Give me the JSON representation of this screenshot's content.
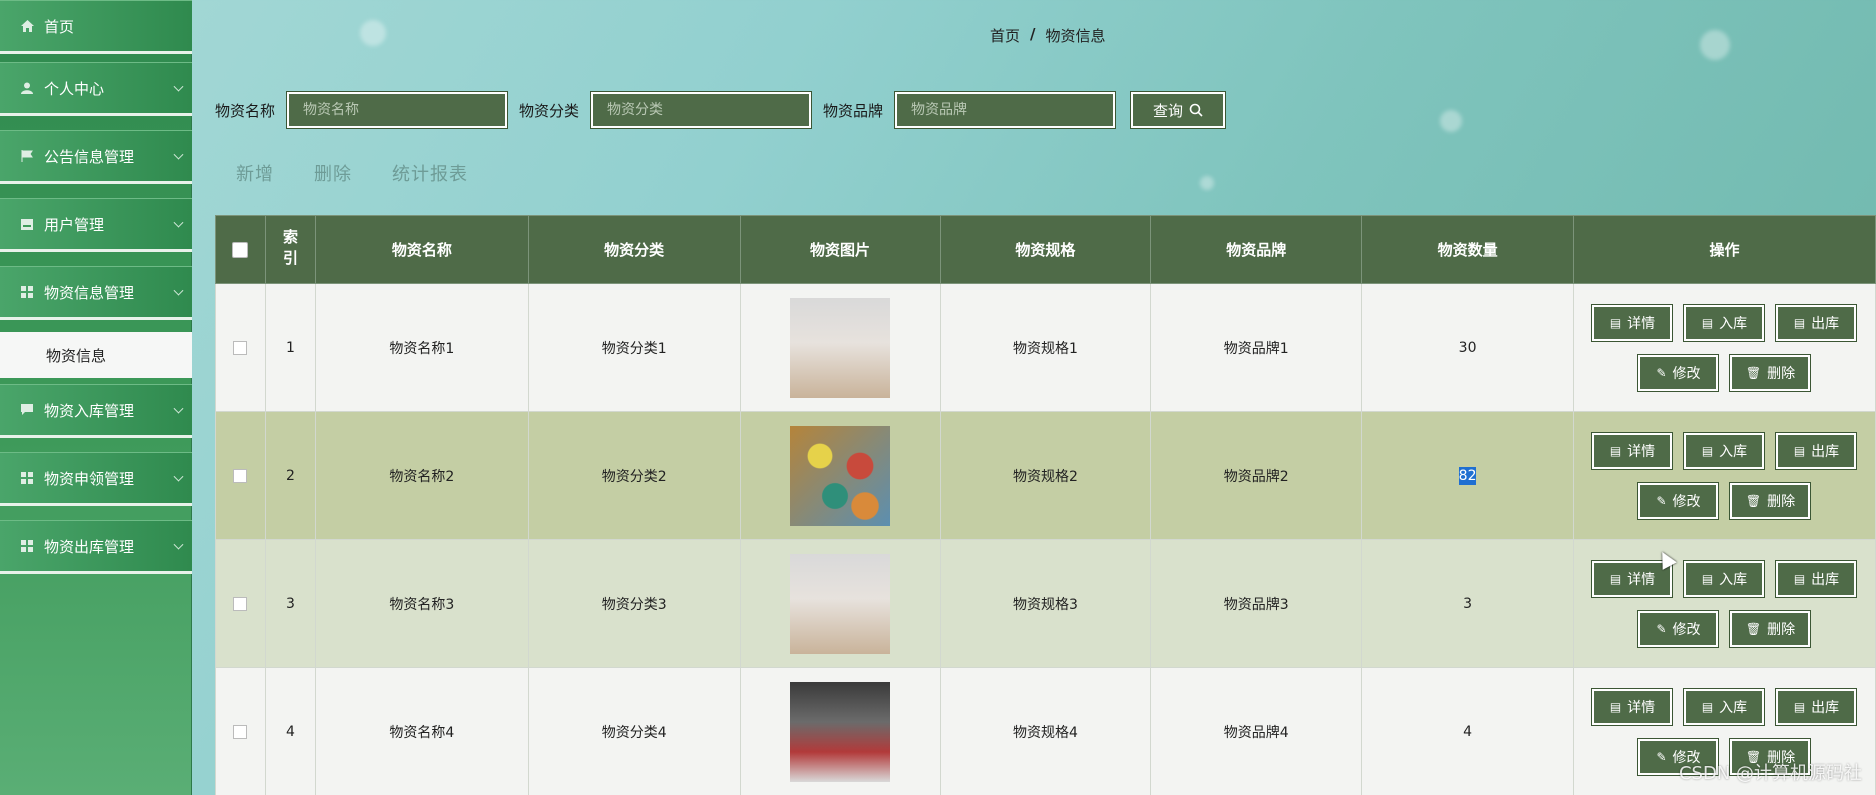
{
  "sidebar": {
    "items": [
      {
        "label": "首页",
        "icon": "home-icon"
      },
      {
        "label": "个人中心",
        "icon": "user-icon"
      },
      {
        "label": "公告信息管理",
        "icon": "flag-icon"
      },
      {
        "label": "用户管理",
        "icon": "card-icon"
      },
      {
        "label": "物资信息管理",
        "icon": "grid-icon"
      },
      {
        "label": "物资入库管理",
        "icon": "chat-icon"
      },
      {
        "label": "物资申领管理",
        "icon": "grid-icon"
      },
      {
        "label": "物资出库管理",
        "icon": "grid-icon"
      }
    ],
    "active_sub": "物资信息"
  },
  "breadcrumb": {
    "home": "首页",
    "separator": "/",
    "current": "物资信息"
  },
  "search": {
    "name_label": "物资名称",
    "name_placeholder": "物资名称",
    "category_label": "物资分类",
    "category_placeholder": "物资分类",
    "brand_label": "物资品牌",
    "brand_placeholder": "物资品牌",
    "query_label": "查询"
  },
  "actions": {
    "add": "新增",
    "delete": "删除",
    "report": "统计报表"
  },
  "table": {
    "headers": [
      "索引",
      "物资名称",
      "物资分类",
      "物资图片",
      "物资规格",
      "物资品牌",
      "物资数量",
      "操作"
    ],
    "rows": [
      {
        "index": "1",
        "name": "物资名称1",
        "category": "物资分类1",
        "spec": "物资规格1",
        "brand": "物资品牌1",
        "qty": "30"
      },
      {
        "index": "2",
        "name": "物资名称2",
        "category": "物资分类2",
        "spec": "物资规格2",
        "brand": "物资品牌2",
        "qty": "82"
      },
      {
        "index": "3",
        "name": "物资名称3",
        "category": "物资分类3",
        "spec": "物资规格3",
        "brand": "物资品牌3",
        "qty": "3"
      },
      {
        "index": "4",
        "name": "物资名称4",
        "category": "物资分类4",
        "spec": "物资规格4",
        "brand": "物资品牌4",
        "qty": "4"
      }
    ],
    "buttons": {
      "detail": "详情",
      "in": "入库",
      "out": "出库",
      "edit": "修改",
      "del": "删除"
    }
  },
  "watermark": "CSDN @计算机源码社",
  "colors": {
    "sidebar": "#2f8a4e",
    "table_header": "#4f6b48",
    "row_highlight": "#c4cea4",
    "selection": "#1f6fd1"
  }
}
